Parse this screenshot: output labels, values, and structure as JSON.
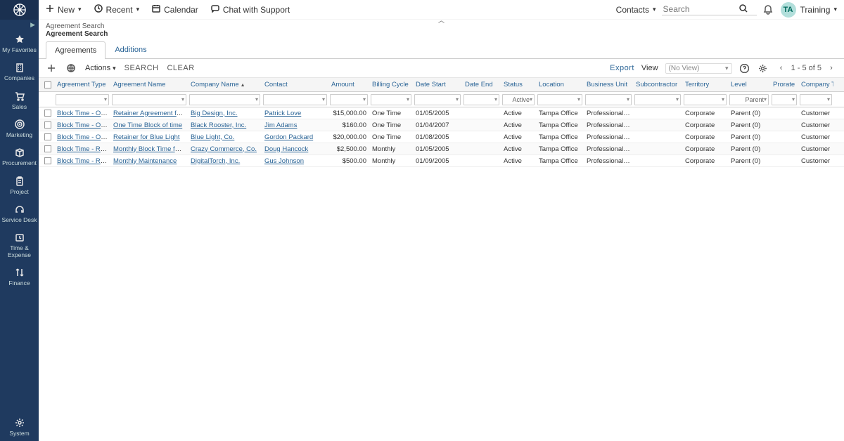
{
  "top": {
    "new": "New",
    "recent": "Recent",
    "calendar": "Calendar",
    "chat": "Chat with Support",
    "contacts": "Contacts",
    "search_placeholder": "Search",
    "avatar": "TA",
    "user": "Training"
  },
  "nav": {
    "items": [
      {
        "label": "My Favorites",
        "icon": "star"
      },
      {
        "label": "Companies",
        "icon": "building"
      },
      {
        "label": "Sales",
        "icon": "cart"
      },
      {
        "label": "Marketing",
        "icon": "target"
      },
      {
        "label": "Procurement",
        "icon": "box"
      },
      {
        "label": "Project",
        "icon": "clipboard"
      },
      {
        "label": "Service Desk",
        "icon": "headset"
      },
      {
        "label": "Time & Expense",
        "icon": "clock"
      },
      {
        "label": "Finance",
        "icon": "arrows"
      }
    ],
    "system": "System"
  },
  "breadcrumb": "Agreement Search",
  "page_title": "Agreement Search",
  "tabs": {
    "agreements": "Agreements",
    "additions": "Additions"
  },
  "toolbar": {
    "actions": "Actions",
    "search": "SEARCH",
    "clear": "CLEAR",
    "export": "Export",
    "view": "View",
    "view_placeholder": "(No View)",
    "pager": "1 - 5 of 5"
  },
  "columns": [
    "Agreement Type",
    "Agreement Name",
    "Company Name",
    "Contact",
    "Amount",
    "Billing Cycle",
    "Date Start",
    "Date End",
    "Status",
    "Location",
    "Business Unit",
    "Subcontractor",
    "Territory",
    "Level",
    "Prorate",
    "Company Type"
  ],
  "sorted_column_index": 2,
  "filters": {
    "status": "Active",
    "level": "Parent"
  },
  "rows": [
    {
      "type": "Block Time - One time",
      "name": "Retainer Agreement for Big Desi",
      "company": "Big Design, Inc.",
      "contact": "Patrick Love",
      "amount": "$15,000.00",
      "cycle": "One Time",
      "start": "01/05/2005",
      "end": "",
      "status": "Active",
      "location": "Tampa Office",
      "bu": "Professional Services",
      "sub": "",
      "territory": "Corporate",
      "level": "Parent (0)",
      "prorate": "",
      "ctype": "Customer"
    },
    {
      "type": "Block Time - One time",
      "name": "One Time Block of time",
      "company": "Black Rooster, Inc.",
      "contact": "Jim Adams",
      "amount": "$160.00",
      "cycle": "One Time",
      "start": "01/04/2007",
      "end": "",
      "status": "Active",
      "location": "Tampa Office",
      "bu": "Professional Services",
      "sub": "",
      "territory": "Corporate",
      "level": "Parent (0)",
      "prorate": "",
      "ctype": "Customer"
    },
    {
      "type": "Block Time - One time",
      "name": "Retainer for Blue Light",
      "company": "Blue Light, Co.",
      "contact": "Gordon Packard",
      "amount": "$20,000.00",
      "cycle": "One Time",
      "start": "01/08/2005",
      "end": "",
      "status": "Active",
      "location": "Tampa Office",
      "bu": "Professional Services",
      "sub": "",
      "territory": "Corporate",
      "level": "Parent (0)",
      "prorate": "",
      "ctype": "Customer"
    },
    {
      "type": "Block Time - Recurring",
      "name": "Monthly Block Time for Crazy C",
      "company": "Crazy Commerce, Co.",
      "contact": "Doug Hancock",
      "amount": "$2,500.00",
      "cycle": "Monthly",
      "start": "01/05/2005",
      "end": "",
      "status": "Active",
      "location": "Tampa Office",
      "bu": "Professional Services",
      "sub": "",
      "territory": "Corporate",
      "level": "Parent (0)",
      "prorate": "",
      "ctype": "Customer"
    },
    {
      "type": "Block Time - Recurring",
      "name": "Monthly Maintenance",
      "company": "DigitalTorch, Inc.",
      "contact": "Gus Johnson",
      "amount": "$500.00",
      "cycle": "Monthly",
      "start": "01/09/2005",
      "end": "",
      "status": "Active",
      "location": "Tampa Office",
      "bu": "Professional Services",
      "sub": "",
      "territory": "Corporate",
      "level": "Parent (0)",
      "prorate": "",
      "ctype": "Customer"
    }
  ]
}
